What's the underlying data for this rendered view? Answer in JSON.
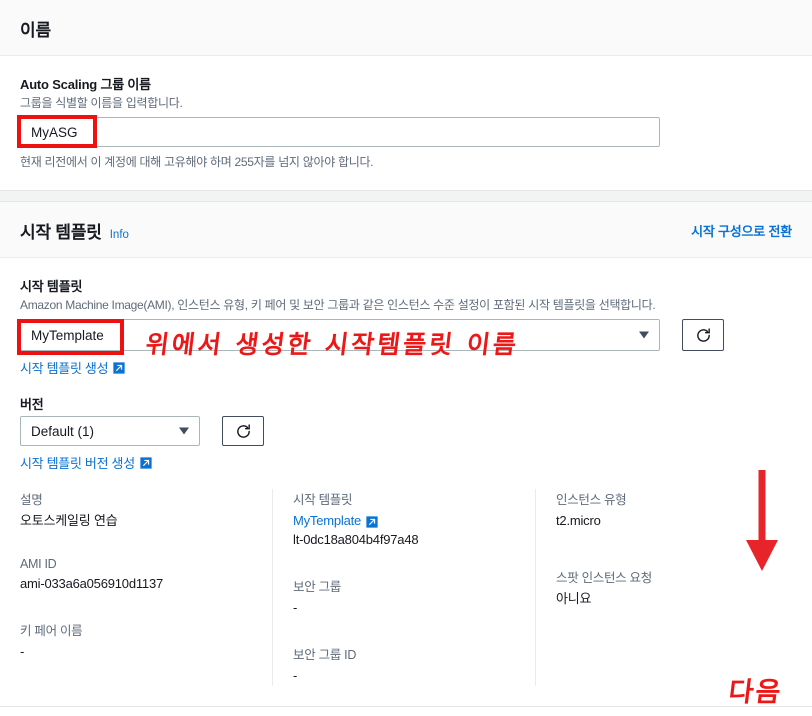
{
  "name_panel": {
    "title": "이름",
    "asg_name": {
      "label": "Auto Scaling 그룹 이름",
      "description": "그룹을 식별할 이름을 입력합니다.",
      "value": "MyASG",
      "placeholder": "",
      "hint": "현재 리전에서 이 계정에 대해 고유해야 하며 255자를 넘지 않아야 합니다."
    }
  },
  "template_panel": {
    "title": "시작 템플릿",
    "info_label": "Info",
    "switch_link": "시작 구성으로 전환",
    "launch_template": {
      "label": "시작 템플릿",
      "description": "Amazon Machine Image(AMI), 인스턴스 유형, 키 페어 및 보안 그룹과 같은 인스턴스 수준 설정이 포함된 시작 템플릿을 선택합니다.",
      "selected": "MyTemplate",
      "create_link": "시작 템플릿 생성",
      "refresh_icon": "refresh-icon"
    },
    "version": {
      "label": "버전",
      "selected": "Default (1)",
      "create_link": "시작 템플릿 버전 생성",
      "refresh_icon": "refresh-icon"
    },
    "details": {
      "col1": [
        {
          "key": "설명",
          "value": "오토스케일링 연습",
          "is_link": false
        },
        {
          "key": "AMI ID",
          "value": "ami-033a6a056910d1137",
          "is_link": false
        },
        {
          "key": "키 페어 이름",
          "value": "-",
          "is_link": false
        }
      ],
      "col2": [
        {
          "key": "시작 템플릿",
          "value": "MyTemplate",
          "is_link": true,
          "sub": "lt-0dc18a804b4f97a48"
        },
        {
          "key": "보안 그룹",
          "value": "-",
          "is_link": false
        },
        {
          "key": "보안 그룹 ID",
          "value": "-",
          "is_link": false
        }
      ],
      "col3": [
        {
          "key": "인스턴스 유형",
          "value": "t2.micro",
          "is_link": false
        },
        {
          "key": "스팟 인스턴스 요청",
          "value": "아니요",
          "is_link": false
        }
      ]
    }
  },
  "annotations": {
    "template_note": "위에서 생성한 시작템플릿 이름",
    "next_note": "다음",
    "highlight_color": "#ee1111",
    "arrow_color": "#e8242b"
  }
}
